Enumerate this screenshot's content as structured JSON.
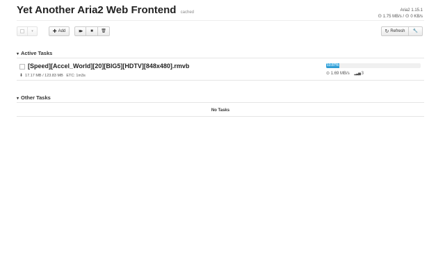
{
  "header": {
    "title": "Yet Another Aria2 Web Frontend",
    "cached_label": "cached",
    "version": "Aria2 1.15.1",
    "download_speed": "1.75 MB/s",
    "upload_speed": "0 KB/s",
    "speed_separator": " / "
  },
  "toolbar": {
    "add_label": "Add",
    "refresh_label": "Refresh"
  },
  "icons": {
    "select_caret": "▾",
    "add": "✚",
    "resume": "▶▶",
    "stop": "■",
    "remove": "🗑",
    "refresh": "↻",
    "settings": "🔧",
    "chevron": "▾",
    "download": "⬇",
    "speed": "⊙",
    "connections": "▂▃▅"
  },
  "active_section": {
    "title": "Active Tasks",
    "tasks": [
      {
        "name": "[Speed][Accel_World][20][BIG5][HDTV][848x480].rmvb",
        "size_progress": "17.17 MB / 123.83 MB",
        "etc": "ETC: 1m3s",
        "progress_label": "13.87%",
        "progress_fraction": 0.1387,
        "speed": "1.69 MB/s",
        "connections": "3"
      }
    ]
  },
  "other_section": {
    "title": "Other Tasks",
    "empty_label": "No Tasks"
  },
  "colors": {
    "progress": "#2a97cf",
    "text": "#333333"
  }
}
